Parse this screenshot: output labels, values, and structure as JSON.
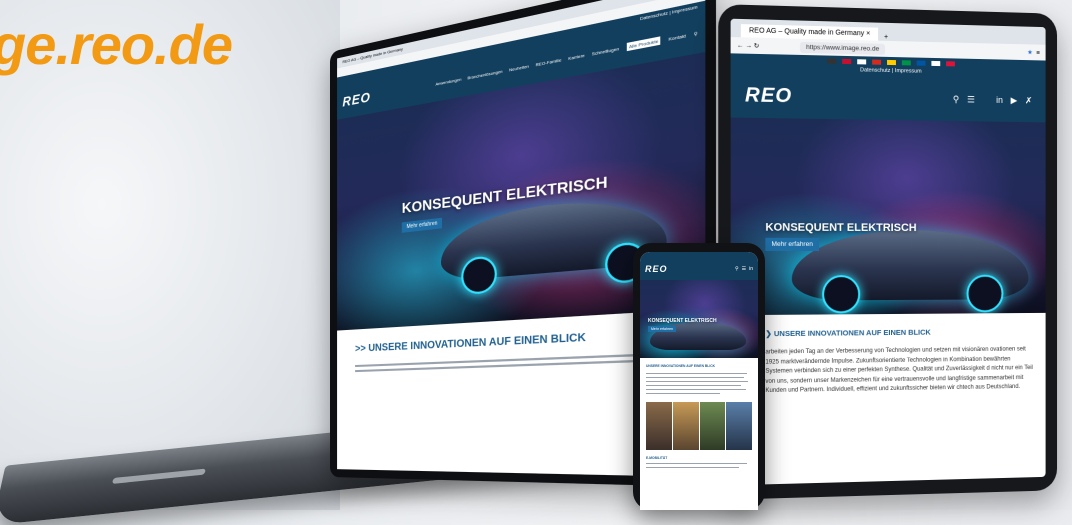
{
  "headline": "ge.reo.de",
  "site": {
    "logo": "REO",
    "hero_title": "KONSEQUENT ELEKTRISCH",
    "hero_button": "Mehr erfahren",
    "section_title": "UNSERE INNOVATIONEN AUF EINEN BLICK",
    "section_body": "arbeiten jeden Tag an der Verbesserung von Technologien und setzen mit visionären ovationen seit 1925 marktverändernde Impulse. Zukunftsorientierte Technologien in Kombination bewährten Systemen verbinden sich zu einer perfekten Synthese. Qualität und Zuverlässigkeit d nicht nur ein Teil von uns, sondern unser Markenzeichen für eine vertrauensvolle und langfristige sammenarbeit mit Kunden und Partnern. Individuell, effizient und zukunftssicher bieten wir chtech aus Deutschland."
  },
  "tablet": {
    "tab_title": "REO AG – Quality made in Germany",
    "url": "https://www.image.reo.de",
    "topbar": "Datenschutz | Impressum"
  },
  "laptop": {
    "nav_items": [
      "Anwendungen",
      "Branchenlösungen",
      "Neuheiten",
      "REO-Familie",
      "Karriere",
      "Schnelllugen",
      "Alle Produkte",
      "Kontakt"
    ],
    "section_title": ">> UNSERE INNOVATIONEN AUF EINEN BLICK",
    "tab_title": "REO AG – Quality made in Germany",
    "topbar": "Datenschutz | Impressum"
  },
  "phone": {
    "section_title": "UNSERE INNOVATIONEN AUF EINEN BLICK",
    "subtitle": "E-MOBILITÄT"
  },
  "colors": {
    "accent": "#f39a14",
    "navy": "#123f5e",
    "button": "#1f6ea6"
  }
}
